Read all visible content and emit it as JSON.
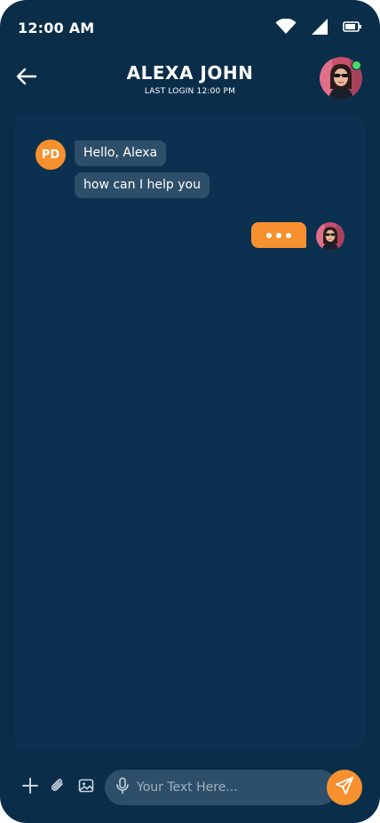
{
  "status_bar": {
    "time": "12:00 AM",
    "icons": [
      "wifi-icon",
      "signal-icon",
      "battery-icon"
    ]
  },
  "header": {
    "back_icon": "arrow-left-icon",
    "title": "ALEXA JOHN",
    "subtitle": "LAST LOGIN 12:00 PM",
    "online": true
  },
  "chat": {
    "sender_initials": "PD",
    "messages": [
      {
        "from": "other",
        "text": "Hello, Alexa"
      },
      {
        "from": "other",
        "text": "how can I help you"
      }
    ],
    "typing_indicator": "..."
  },
  "composer": {
    "tools": [
      "plus-icon",
      "paperclip-icon",
      "image-icon"
    ],
    "mic_icon": "microphone-icon",
    "placeholder": "Your Text Here...",
    "value": "",
    "send_icon": "send-icon"
  },
  "colors": {
    "background": "#0a2e4a",
    "panel": "#0c3150",
    "bubble": "#2e4f69",
    "accent": "#f7902f",
    "online": "#4cd964"
  }
}
